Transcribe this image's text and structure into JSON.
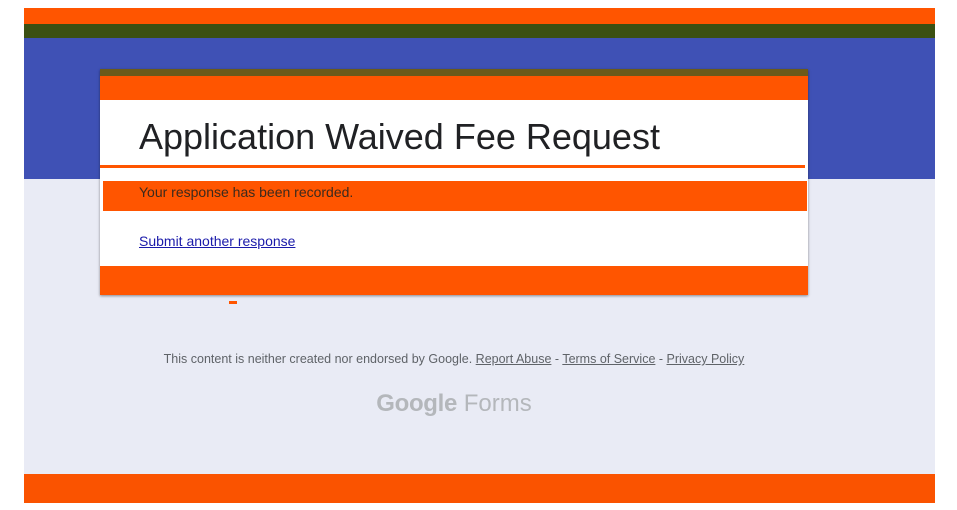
{
  "form": {
    "title": "Application Waived Fee Request",
    "confirmation_message": "Your response has been recorded.",
    "submit_another_label": "Submit another response"
  },
  "footer": {
    "disclaimer": "This content is neither created nor endorsed by Google.",
    "report_abuse_label": "Report Abuse",
    "separator": " - ",
    "terms_label": "Terms of Service",
    "privacy_label": "Privacy Policy"
  },
  "brand": {
    "google": "Google",
    "forms": "Forms"
  },
  "colors": {
    "header_blue": "#3f51b5",
    "accent_orange": "#ff5500",
    "page_background": "#e9ebf5",
    "link_blue": "#1a1aaa"
  }
}
